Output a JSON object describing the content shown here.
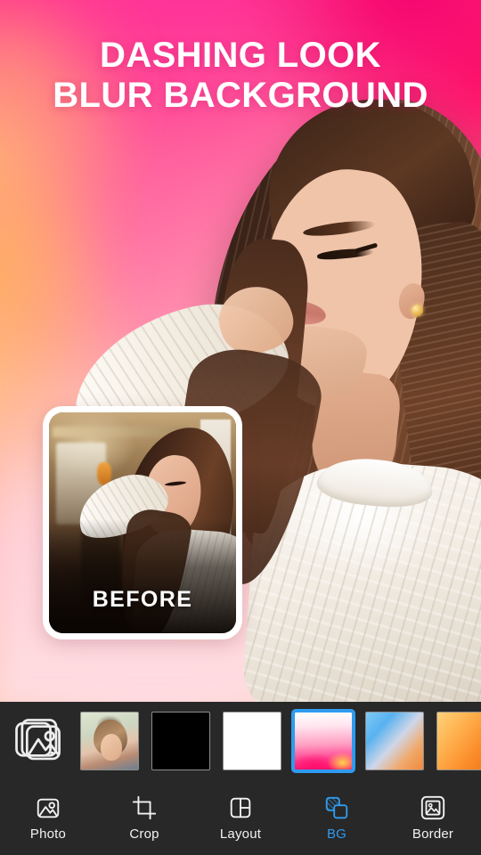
{
  "headline": {
    "line1": "DASHING LOOK",
    "line2": "BLUR BACKGROUND"
  },
  "preview": {
    "before_card": {
      "label": "BEFORE"
    }
  },
  "background_strip": {
    "gallery_button": {
      "icon": "gallery-stack-icon"
    },
    "thumbnails": [
      {
        "id": "photo",
        "type": "image",
        "label": "Photo background",
        "selected": false
      },
      {
        "id": "black",
        "type": "color",
        "label": "Black",
        "color": "#000000",
        "selected": false
      },
      {
        "id": "white",
        "type": "color",
        "label": "White",
        "color": "#ffffff",
        "selected": false
      },
      {
        "id": "pink",
        "type": "gradient",
        "label": "Pink gradient",
        "color": "#ff1166",
        "selected": true
      },
      {
        "id": "blue",
        "type": "gradient",
        "label": "Blue gradient",
        "color": "#58b2f0",
        "selected": false
      },
      {
        "id": "orange",
        "type": "gradient",
        "label": "Orange gradient",
        "color": "#fb8c2a",
        "selected": false
      }
    ]
  },
  "bottom_nav": {
    "active": "bg",
    "items": [
      {
        "id": "photo",
        "label": "Photo",
        "icon": "photo-icon"
      },
      {
        "id": "crop",
        "label": "Crop",
        "icon": "crop-icon"
      },
      {
        "id": "layout",
        "label": "Layout",
        "icon": "layout-icon"
      },
      {
        "id": "bg",
        "label": "BG",
        "icon": "bg-icon"
      },
      {
        "id": "border",
        "label": "Border",
        "icon": "border-icon"
      }
    ]
  },
  "colors": {
    "accent": "#2e9bf0",
    "panel": "#282828",
    "text": "#f2f2f2"
  }
}
